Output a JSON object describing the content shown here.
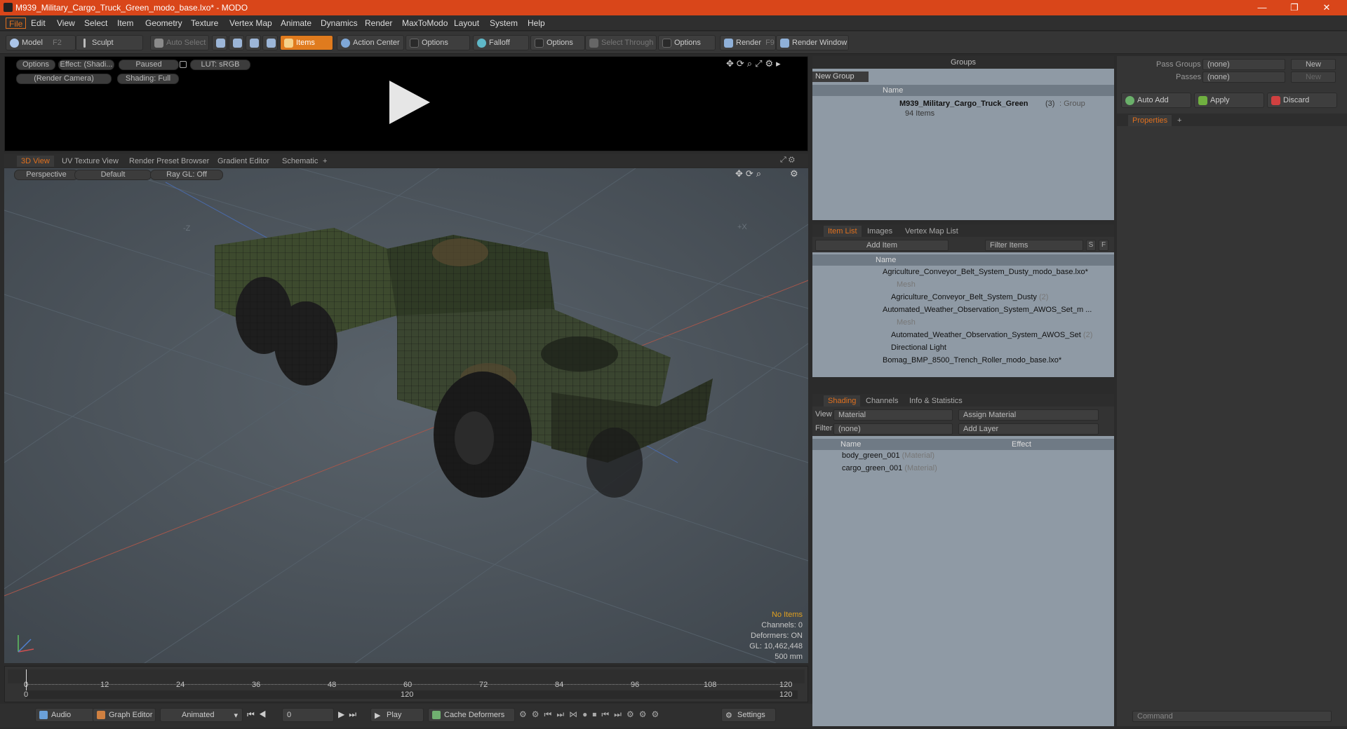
{
  "window": {
    "title": "M939_Military_Cargo_Truck_Green_modo_base.lxo* - MODO",
    "min": "—",
    "restore": "❐",
    "close": "✕"
  },
  "menu": [
    "File",
    "Edit",
    "View",
    "Select",
    "Item",
    "Geometry",
    "Texture",
    "Vertex Map",
    "Animate",
    "Dynamics",
    "Render",
    "MaxToModo",
    "Layout",
    "System",
    "Help"
  ],
  "toolbar": {
    "model": "Model",
    "model_key": "F2",
    "sculpt": "Sculpt",
    "auto_select": "Auto Select",
    "items": "Items",
    "action_center": "Action Center",
    "options1": "Options",
    "falloff": "Falloff",
    "options2": "Options",
    "select_through": "Select Through",
    "options3": "Options",
    "render": "Render",
    "render_key": "F9",
    "render_window": "Render Window"
  },
  "preview": {
    "options": "Options",
    "effect": "Effect: (Shadi...",
    "paused": "Paused",
    "lut": "LUT: sRGB",
    "camera": "(Render Camera)",
    "shading": "Shading: Full"
  },
  "view_tabs": [
    "3D View",
    "UV Texture View",
    "Render Preset Browser",
    "Gradient Editor",
    "Schematic"
  ],
  "viewport": {
    "perspective": "Perspective",
    "default": "Default",
    "raygl": "Ray GL: Off",
    "axis_z": "-Z",
    "axis_x": "+X",
    "stats": {
      "no_items": "No Items",
      "channels": "Channels: 0",
      "deformers": "Deformers: ON",
      "gl": "GL: 10,462,448",
      "size": "500 mm"
    }
  },
  "timeline": {
    "ticks": [
      "0",
      "12",
      "24",
      "36",
      "48",
      "60",
      "72",
      "84",
      "96",
      "108",
      "120"
    ],
    "lower": [
      "0",
      "120",
      "120"
    ]
  },
  "bottom": {
    "audio": "Audio",
    "graph_editor": "Graph Editor",
    "animated": "Animated",
    "frame": "0",
    "play": "Play",
    "cache": "Cache Deformers",
    "settings": "Settings"
  },
  "groups": {
    "title": "Groups",
    "new_group": "New Group",
    "name_col": "Name",
    "item_name": "M939_Military_Cargo_Truck_Green",
    "item_count": "(3)",
    "item_type": ": Group",
    "item_sub": "94 Items"
  },
  "itemlist": {
    "tabs": [
      "Item List",
      "Images",
      "Vertex Map List"
    ],
    "add_item": "Add Item",
    "filter": "Filter Items",
    "s": "S",
    "f": "F",
    "name_col": "Name",
    "rows": [
      {
        "text": "Agriculture_Conveyor_Belt_System_Dusty_modo_base.lxo*",
        "extra": ""
      },
      {
        "text": "Mesh",
        "extra": ""
      },
      {
        "text": "Agriculture_Conveyor_Belt_System_Dusty",
        "extra": "(2)"
      },
      {
        "text": "Automated_Weather_Observation_System_AWOS_Set_m ...",
        "extra": ""
      },
      {
        "text": "Mesh",
        "extra": ""
      },
      {
        "text": "Automated_Weather_Observation_System_AWOS_Set",
        "extra": "(2)"
      },
      {
        "text": "Directional Light",
        "extra": ""
      },
      {
        "text": "Bomag_BMP_8500_Trench_Roller_modo_base.lxo*",
        "extra": ""
      }
    ]
  },
  "shading": {
    "tabs": [
      "Shading",
      "Channels",
      "Info & Statistics"
    ],
    "view_label": "View",
    "view_value": "Material",
    "assign": "Assign Material",
    "filter_label": "Filter",
    "filter_value": "(none)",
    "add_layer": "Add Layer",
    "name_col": "Name",
    "effect_col": "Effect",
    "rows": [
      {
        "name": "body_green_001",
        "type": "(Material)"
      },
      {
        "name": "cargo_green_001",
        "type": "(Material)"
      }
    ]
  },
  "right": {
    "pass_groups": "Pass Groups",
    "pass_value": "(none)",
    "new": "New",
    "passes": "Passes",
    "passes_value": "(none)",
    "new2": "New",
    "auto_add": "Auto Add",
    "apply": "Apply",
    "discard": "Discard",
    "properties": "Properties",
    "command": "Command"
  }
}
